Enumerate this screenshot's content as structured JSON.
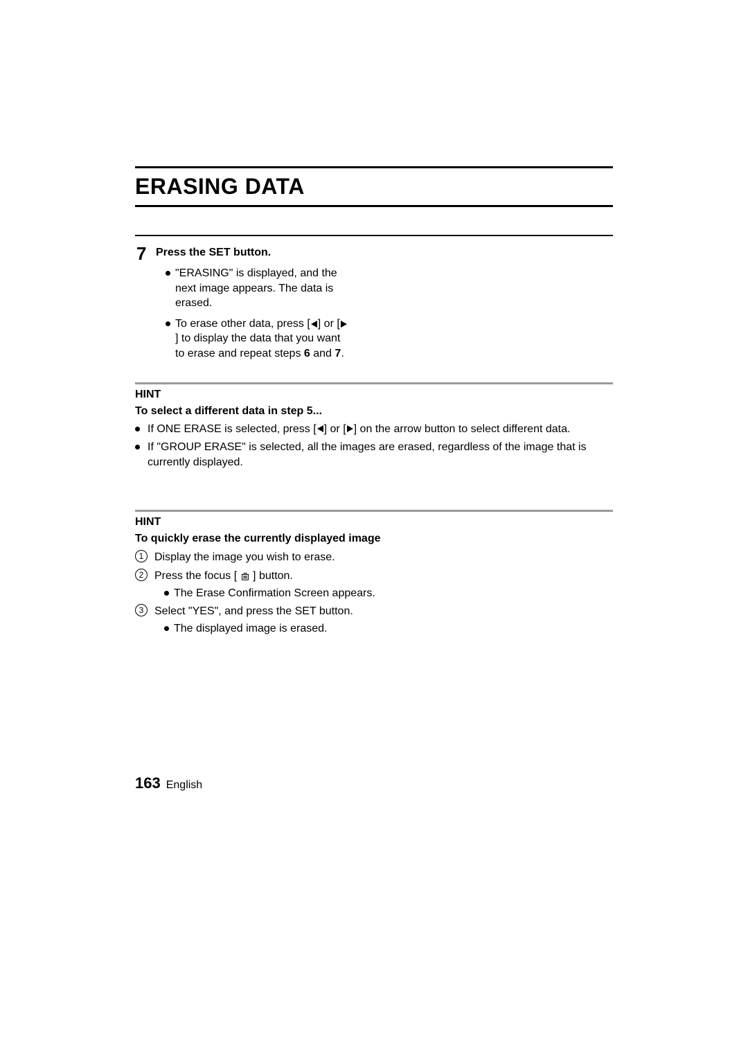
{
  "title": "ERASING DATA",
  "step": {
    "number": "7",
    "heading": "Press the SET button.",
    "bullet1_a": "\"ERASING\" is displayed, and the next image appears. The data is erased.",
    "bullet2_a": "To erase other data, press [",
    "bullet2_b": "] or [",
    "bullet2_c": "] to display the data that you want to erase and repeat steps ",
    "bullet2_d": "6",
    "bullet2_e": " and ",
    "bullet2_f": "7",
    "bullet2_g": "."
  },
  "hint1": {
    "label": "HINT",
    "subheading": "To select a different data in step 5...",
    "bullet1_a": "If ONE ERASE is selected, press [",
    "bullet1_b": "] or [",
    "bullet1_c": "] on the arrow button to select different data.",
    "bullet2": "If \"GROUP ERASE\" is selected, all the images are erased, regardless of the image that is currently displayed."
  },
  "hint2": {
    "label": "HINT",
    "subheading": "To quickly erase the currently displayed image",
    "item1": "Display the image you wish to erase.",
    "item2_a": "Press the focus [ ",
    "item2_b": " ] button.",
    "item2_sub": "The Erase Confirmation Screen appears.",
    "item3": "Select \"YES\", and press the SET button.",
    "item3_sub": "The displayed image is erased."
  },
  "footer": {
    "page": "163",
    "lang": "English"
  }
}
